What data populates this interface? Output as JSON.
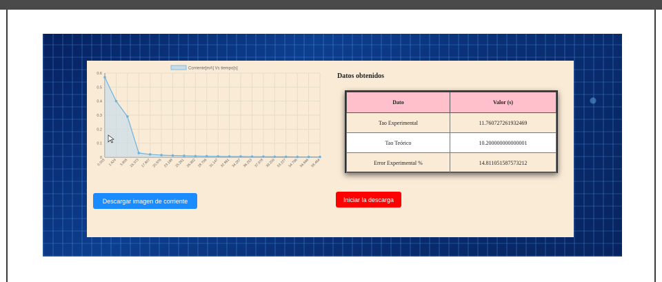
{
  "chart": {
    "legend": "Corriente[mA] Vs tiempo[s]",
    "colors": {
      "fill": "#c9dde8",
      "line": "#6fb3dd",
      "grid": "#e6dccb",
      "axis": "#888"
    }
  },
  "chart_data": {
    "type": "area",
    "x": [
      "0.003",
      "1.624",
      "3.905",
      "16.373",
      "17.807",
      "20.876",
      "23.188",
      "25.261",
      "26.992",
      "28.706",
      "31.147",
      "32.861",
      "34.287",
      "36.253",
      "37.978",
      "39.209",
      "53.227",
      "54.796",
      "56.666",
      "58.464"
    ],
    "series": [
      {
        "name": "Corriente[mA] Vs tiempo[s]",
        "values": [
          0.57,
          0.4,
          0.29,
          0.03,
          0.02,
          0.015,
          0.012,
          0.01,
          0.008,
          0.007,
          0.006,
          0.005,
          0.005,
          0.004,
          0.004,
          0.003,
          0.003,
          0.002,
          0.002,
          0.002
        ]
      }
    ],
    "ylim": [
      0,
      0.6
    ],
    "yticks": [
      "0",
      "0.1",
      "0.2",
      "0.3",
      "0.4",
      "0.5",
      "0.6"
    ],
    "grid": true,
    "legend": "top-center"
  },
  "info": {
    "title": "Datos obtenidos",
    "headers": [
      "Dato",
      "Valor (s)"
    ],
    "rows": [
      {
        "label": "Tao Experimental",
        "value": "11.760727261932469"
      },
      {
        "label": "Tao Teórico",
        "value": "10.200000000000001"
      },
      {
        "label": "Error Experimental %",
        "value": "14.811051587573212"
      }
    ]
  },
  "buttons": {
    "download_image": "Descargar imagen de corriente",
    "start_download": "Iniciar la descarga"
  },
  "background": {
    "panel_color": "#faebd7"
  }
}
